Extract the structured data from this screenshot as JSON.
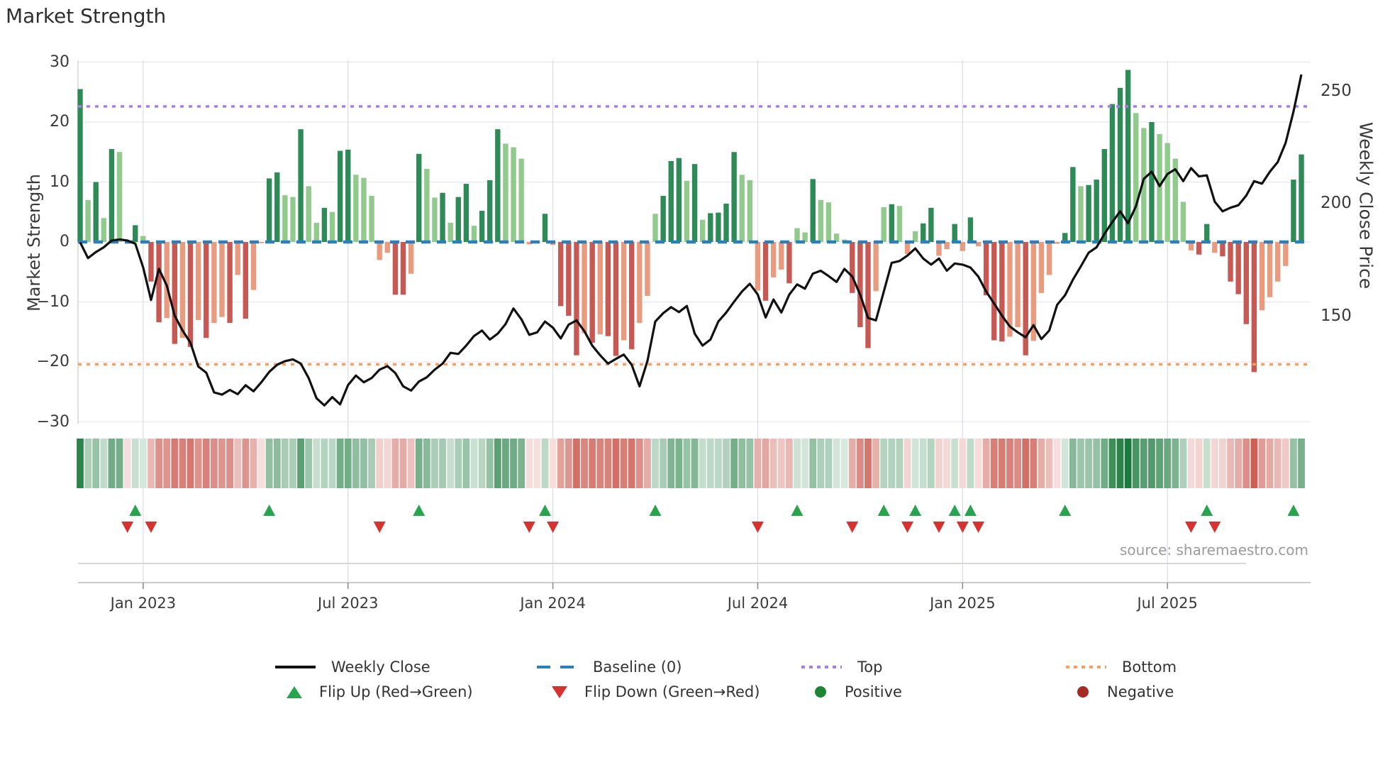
{
  "title": "Market Strength",
  "source": "source: sharemaestro.com",
  "left_axis": {
    "label": "Market Strength",
    "tick_labels": [
      "30",
      "20",
      "10",
      "0",
      "−10",
      "−20",
      "−30"
    ],
    "tick_values": [
      30,
      20,
      10,
      0,
      -10,
      -20,
      -30
    ]
  },
  "right_axis": {
    "label": "Weekly Close Price",
    "tick_labels": [
      "250",
      "200",
      "150"
    ],
    "tick_values": [
      250,
      200,
      150
    ]
  },
  "x_axis": {
    "tick_labels": [
      "Jan 2023",
      "Jul 2023",
      "Jan 2024",
      "Jul 2024",
      "Jan 2025",
      "Jul 2025"
    ],
    "tick_week_indices": [
      8,
      34,
      60,
      86,
      112,
      138
    ]
  },
  "legend": {
    "items": [
      {
        "label": "Weekly Close",
        "swatch": "black-line"
      },
      {
        "label": "Baseline (0)",
        "swatch": "blue-dashed-line"
      },
      {
        "label": "Top",
        "swatch": "purple-dotted-line"
      },
      {
        "label": "Bottom",
        "swatch": "orange-dotted-line"
      },
      {
        "label": "Flip Up (Red→Green)",
        "swatch": "green-up-triangle"
      },
      {
        "label": "Flip Down (Green→Red)",
        "swatch": "red-down-triangle"
      },
      {
        "label": "Positive",
        "swatch": "green-circle"
      },
      {
        "label": "Negative",
        "swatch": "dark-red-circle"
      }
    ]
  },
  "colors": {
    "bar_positive_dark": "#2e8b57",
    "bar_positive_light": "#92c98c",
    "bar_negative_dark": "#c65953",
    "bar_negative_light": "#e89b7f",
    "weekly_close_line": "#111111",
    "baseline": "#2c7fb8",
    "top_line": "#a77fe0",
    "bottom_line": "#f5a15d",
    "flip_up_marker": "#28a44e",
    "flip_down_marker": "#d63230",
    "positive_legend": "#1d8533",
    "negative_legend": "#a52a21",
    "grid": "#e8e8f0",
    "heat_green_base": "#1b7a3d",
    "heat_red_base": "#c1392d"
  },
  "chart_data": {
    "type": "bar+line",
    "n_weeks": 156,
    "strength_ylim": [
      -30,
      30
    ],
    "baseline": 0,
    "top_line": 22.6,
    "bottom_line": -20.4,
    "legend_position": "bottom",
    "grid": true,
    "bar_values": [
      25.5,
      7,
      10,
      4,
      15.5,
      15,
      -0.3,
      2.8,
      1,
      -6.6,
      -13.4,
      -12.7,
      -17,
      -16,
      -17.5,
      -13,
      -16,
      -13.5,
      -12.5,
      -13.5,
      -5.5,
      -12.8,
      -8,
      -0.2,
      10.6,
      11.6,
      7.8,
      7.5,
      18.8,
      9.3,
      3.2,
      5.7,
      5,
      15.2,
      15.4,
      11.2,
      10.7,
      7.7,
      -3,
      -1.8,
      -8.8,
      -8.8,
      -5.3,
      14.7,
      12.2,
      7.4,
      8.2,
      3.2,
      7.5,
      9.7,
      2.7,
      5.2,
      10.3,
      18.8,
      16.4,
      15.8,
      13.9,
      -0.4,
      -0.2,
      4.7,
      -0.5,
      -10.7,
      -12.3,
      -18.9,
      -15.2,
      -16.8,
      -15.4,
      -15.7,
      -19,
      -16.4,
      -17.9,
      -13.5,
      -9,
      4.7,
      7.7,
      13.5,
      14,
      10.2,
      13,
      3.7,
      4.8,
      4.9,
      6.4,
      15,
      11.2,
      10.3,
      -8.1,
      -9.8,
      -5.9,
      -4.6,
      -6.9,
      2.3,
      1.6,
      10.5,
      7,
      6.6,
      1.4,
      0.4,
      -8.5,
      -14.2,
      -17.7,
      -8.2,
      5.8,
      6.3,
      6,
      -2,
      1.8,
      3.1,
      5.7,
      -2.3,
      -1.2,
      3,
      -1.5,
      4.1,
      -0.7,
      -8.9,
      -16.4,
      -16.6,
      -15.8,
      -14.2,
      -18.9,
      -16.5,
      -8.5,
      -5.5,
      -0.3,
      1.5,
      12.5,
      9.3,
      9.5,
      10.4,
      15.5,
      23,
      25.7,
      28.7,
      21.5,
      19,
      20,
      18,
      16.5,
      13.9,
      6.7,
      -1.4,
      -2.1,
      3,
      -1.8,
      -2.4,
      -6.6,
      -8.7,
      -13.7,
      -21.7,
      -11.4,
      -9.2,
      -6.6,
      -4,
      10.4,
      14.6
    ],
    "weekly_close": [
      182.8,
      175.8,
      178.5,
      180.6,
      183.6,
      184.1,
      183.6,
      182.2,
      171.6,
      157.2,
      171.0,
      163.6,
      150.2,
      143.6,
      138.2,
      127.6,
      124.9,
      116.1,
      115.1,
      117.2,
      115.3,
      119.3,
      116.6,
      120.6,
      125.2,
      128.4,
      130.0,
      130.8,
      128.9,
      122.5,
      113.5,
      110.3,
      114.0,
      110.8,
      119.3,
      123.6,
      120.6,
      122.5,
      126.2,
      127.8,
      124.7,
      118.8,
      116.9,
      120.9,
      122.8,
      126.2,
      128.9,
      133.7,
      133.2,
      136.9,
      141.2,
      143.6,
      139.6,
      142.2,
      146.5,
      153.4,
      148.6,
      141.7,
      142.8,
      147.6,
      144.9,
      140.1,
      146.2,
      148.1,
      143.3,
      136.9,
      132.6,
      128.9,
      131.0,
      132.9,
      128.4,
      118.8,
      130.0,
      147.6,
      151.3,
      154.0,
      151.8,
      154.5,
      142.2,
      136.9,
      139.6,
      147.6,
      151.6,
      156.4,
      160.9,
      164.4,
      159.6,
      149.4,
      157.4,
      151.6,
      159.6,
      164.1,
      162.2,
      168.9,
      170.2,
      167.8,
      165.2,
      171.0,
      167.6,
      159.6,
      149.2,
      148.1,
      160.9,
      173.7,
      174.5,
      176.9,
      180.1,
      175.6,
      172.9,
      175.6,
      170.2,
      173.4,
      172.9,
      171.6,
      167.6,
      160.9,
      155.6,
      150.2,
      145.4,
      142.8,
      140.6,
      146.0,
      139.8,
      143.6,
      155.0,
      159.3,
      166.2,
      172.1,
      178.2,
      180.6,
      186.5,
      191.8,
      196.6,
      191.3,
      198.8,
      211.0,
      214.2,
      207.8,
      213.2,
      215.3,
      210.0,
      215.8,
      212.1,
      212.6,
      200.9,
      196.6,
      198.2,
      199.3,
      203.6,
      210.0,
      208.9,
      214.2,
      218.5,
      227.0,
      240.9,
      257.4
    ],
    "flip_up_indices": [
      7,
      24,
      43,
      59,
      73,
      91,
      102,
      106,
      111,
      113,
      125,
      143,
      154
    ],
    "flip_down_indices": [
      6,
      9,
      38,
      57,
      60,
      86,
      98,
      105,
      109,
      112,
      114,
      141,
      144
    ],
    "heatmap_source": "bar_values"
  }
}
